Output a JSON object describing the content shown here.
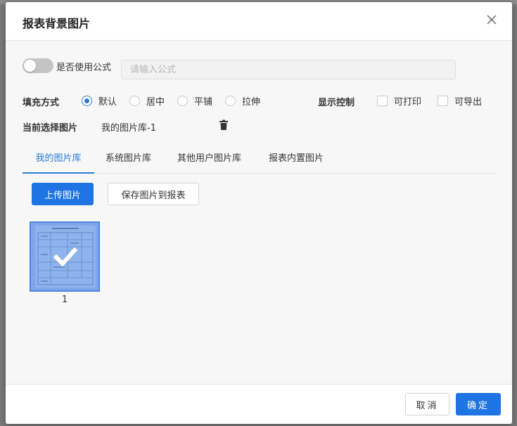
{
  "dialog": {
    "title": "报表背景图片",
    "close_glyph": "X"
  },
  "formula": {
    "toggle_on": false,
    "toggle_label": "是否使用公式",
    "input_value": "",
    "input_placeholder": "请输入公式"
  },
  "fill_mode": {
    "label": "填充方式",
    "options": [
      {
        "label": "默认",
        "checked": true
      },
      {
        "label": "居中",
        "checked": false
      },
      {
        "label": "平铺",
        "checked": false
      },
      {
        "label": "拉伸",
        "checked": false
      }
    ]
  },
  "display_control": {
    "label": "显示控制",
    "options": [
      {
        "label": "可打印",
        "checked": false
      },
      {
        "label": "可导出",
        "checked": false
      }
    ]
  },
  "current_image": {
    "label": "当前选择图片",
    "value": "我的图片库-1",
    "delete_icon": "trash-icon"
  },
  "tabs": [
    {
      "label": "我的图片库",
      "active": true
    },
    {
      "label": "系统图片库",
      "active": false
    },
    {
      "label": "其他用户图片库",
      "active": false
    },
    {
      "label": "报表内置图片",
      "active": false
    }
  ],
  "actions": {
    "upload_label": "上传图片",
    "save_to_report_label": "保存图片到报表"
  },
  "gallery": {
    "items": [
      {
        "caption": "1",
        "selected": true
      }
    ]
  },
  "footer": {
    "cancel_label": "取消",
    "ok_label": "确定"
  },
  "colors": {
    "accent": "#1e74e3",
    "selected_overlay": "#7fa7e8",
    "toggle_off": "#c4c4c4"
  }
}
